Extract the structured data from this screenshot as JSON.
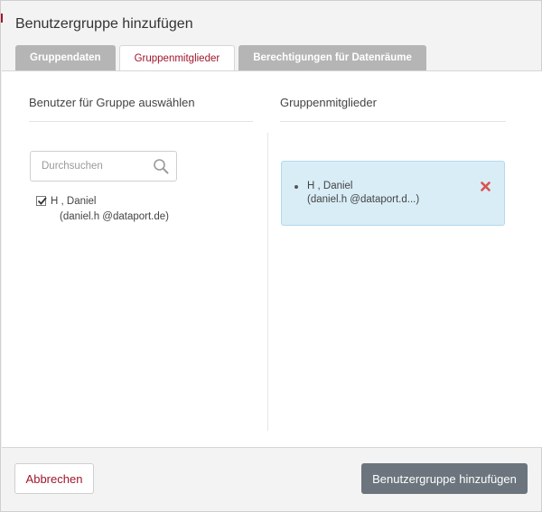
{
  "dialog": {
    "title": "Benutzergruppe hinzufügen"
  },
  "tabs": [
    {
      "label": "Gruppendaten",
      "active": false
    },
    {
      "label": "Gruppenmitglieder",
      "active": true
    },
    {
      "label": "Berechtigungen für Datenräume",
      "active": false
    }
  ],
  "left_panel": {
    "header": "Benutzer für Gruppe auswählen",
    "search": {
      "placeholder": "Durchsuchen",
      "value": ""
    },
    "users": [
      {
        "name": "H        , Daniel",
        "email": "(daniel.h          @dataport.de)",
        "checked": true
      }
    ]
  },
  "right_panel": {
    "header": "Gruppenmitglieder",
    "members": [
      {
        "name": "H        , Daniel",
        "email": "(daniel.h          @dataport.d...)"
      }
    ]
  },
  "footer": {
    "cancel_label": "Abbrechen",
    "submit_label": "Benutzergruppe hinzufügen"
  },
  "colors": {
    "accent": "#a0162b",
    "tab_inactive": "#b5b5b5",
    "member_box": "#d9edf7",
    "remove_icon": "#d9534f",
    "primary_button": "#6c757d"
  }
}
